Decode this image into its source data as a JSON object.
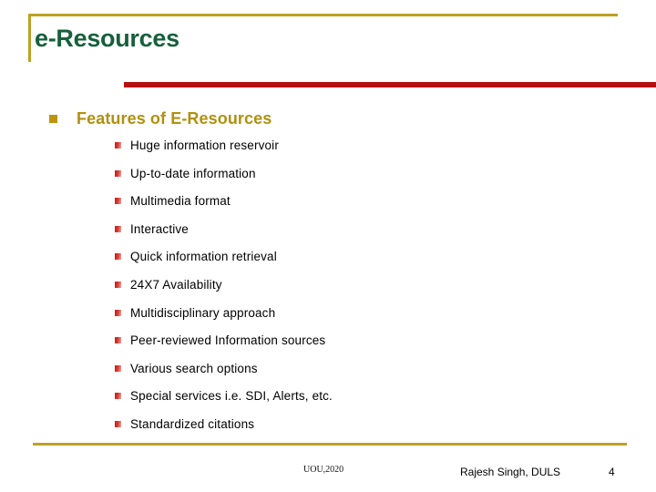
{
  "slide": {
    "title": "e-Resources",
    "page_number": "4",
    "colors": {
      "title_green": "#17603C",
      "frame_gold": "#BFA022",
      "accent_red": "#B41010",
      "heading_gold": "#B1900F",
      "bullet_red": "#C0201C",
      "background": "#FFFFFF",
      "body_text": "#000000"
    },
    "heading": {
      "bullet_icon": "gold-square-bullet",
      "text": "Features of E-Resources"
    },
    "bullets": [
      {
        "icon": "red-square-bullet",
        "label": "Huge information reservoir"
      },
      {
        "icon": "red-square-bullet",
        "label": "Up-to-date information"
      },
      {
        "icon": "red-square-bullet",
        "label": "Multimedia format"
      },
      {
        "icon": "red-square-bullet",
        "label": "Interactive"
      },
      {
        "icon": "red-square-bullet",
        "label": "Quick information retrieval"
      },
      {
        "icon": "red-square-bullet",
        "label": "24X7 Availability"
      },
      {
        "icon": "red-square-bullet",
        "label": "Multidisciplinary approach"
      },
      {
        "icon": "red-square-bullet",
        "label": "Peer-reviewed Information sources"
      },
      {
        "icon": "red-square-bullet",
        "label": "Various search options"
      },
      {
        "icon": "red-square-bullet",
        "label": "Special services i.e. SDI, Alerts, etc."
      },
      {
        "icon": "red-square-bullet",
        "label": "Standardized citations"
      }
    ],
    "footer": {
      "source": "UOU,2020",
      "author": "Rajesh Singh, DULS"
    }
  }
}
